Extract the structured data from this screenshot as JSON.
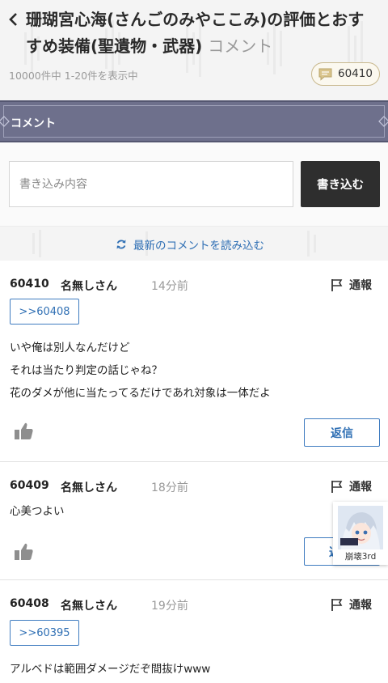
{
  "header": {
    "title": "珊瑚宮心海(さんごのみやここみ)の評価とおすすめ装備(聖遺物・武器)",
    "title_suffix": "コメント",
    "count_text": "10000件中 1-20件を表示中",
    "comment_total": "60410"
  },
  "section": {
    "title": "コメント"
  },
  "compose": {
    "placeholder": "書き込み内容",
    "submit_label": "書き込む"
  },
  "reload": {
    "label": "最新のコメントを読み込む"
  },
  "comments": [
    {
      "number": "60410",
      "author": "名無しさん",
      "time": "14分前",
      "report_label": "通報",
      "anchor": ">>60408",
      "lines": [
        "いや俺は別人なんだけど",
        "それは当たり判定の話じゃね？",
        "花のダメが他に当たってるだけであれ対象は一体だよ"
      ],
      "reply_label": "返信"
    },
    {
      "number": "60409",
      "author": "名無しさん",
      "time": "18分前",
      "report_label": "通報",
      "lines": [
        "心美つよい"
      ],
      "reply_label": "返"
    },
    {
      "number": "60408",
      "author": "名無しさん",
      "time": "19分前",
      "report_label": "通報",
      "anchor": ">>60395",
      "lines": [
        "アルベドは範囲ダメージだぞ間抜けwww"
      ]
    }
  ],
  "floating_ad": {
    "label": "崩壊3rd"
  },
  "colors": {
    "accent": "#2f6fb4",
    "section_bar": "#6e708c",
    "submit": "#2e2e2e",
    "badge_border": "#c9b98f"
  },
  "icons": [
    "chevron-left-icon",
    "speech-bubble-icon",
    "refresh-icon",
    "flag-icon",
    "thumbs-up-icon"
  ]
}
